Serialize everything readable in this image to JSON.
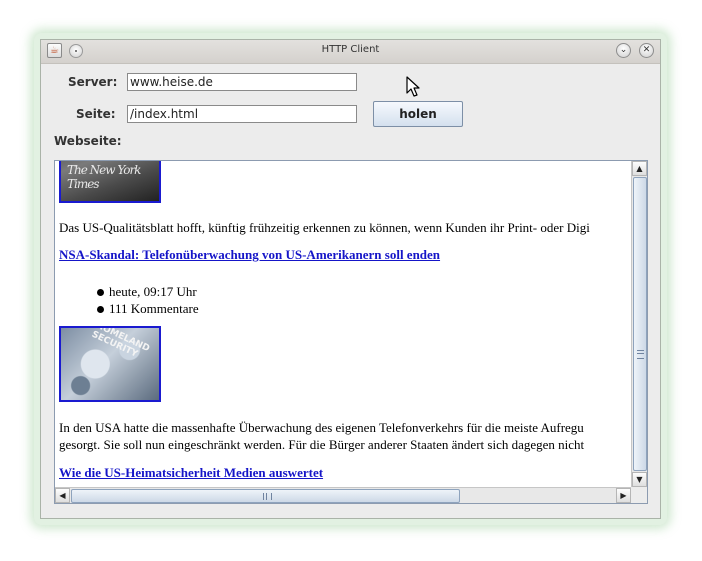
{
  "window": {
    "title": "HTTP Client",
    "app_icon": "java-icon",
    "controls": [
      "window-menu-icon",
      "minimize-icon",
      "close-icon"
    ]
  },
  "form": {
    "server_label": "Server:",
    "server_value": "www.heise.de",
    "page_label": "Seite:",
    "page_value": "/index.html",
    "fetch_button": "holen",
    "webpage_label": "Webseite:"
  },
  "webpage": {
    "image1_caption": "The New York Times",
    "paragraph1": "Das US-Qualitätsblatt hofft, künftig frühzeitig erkennen zu können, wenn Kunden ihr Print- oder Digi",
    "link1": "NSA-Skandal: Telefonüberwachung von US-Amerikanern soll enden",
    "bullets": [
      "heute, 09:17 Uhr",
      "111 Kommentare"
    ],
    "image2_caption": "HOMELAND SECURITY",
    "paragraph2_line1": "In den USA hatte die massenhafte Überwachung des eigenen Telefonverkehrs für die meiste Aufregu",
    "paragraph2_line2": "gesorgt. Sie soll nun eingeschränkt werden. Für die Bürger anderer Staaten ändert sich dagegen nicht",
    "link2": "Wie die US-Heimatsicherheit Medien auswertet"
  },
  "colors": {
    "link": "#1515c8",
    "image_border": "#1a1ad0",
    "button_gradient_top": "#f6f9fd",
    "button_gradient_bottom": "#d4e0ee"
  },
  "scrollbars": {
    "vertical_position": 0.52,
    "horizontal_position": 0.0
  }
}
